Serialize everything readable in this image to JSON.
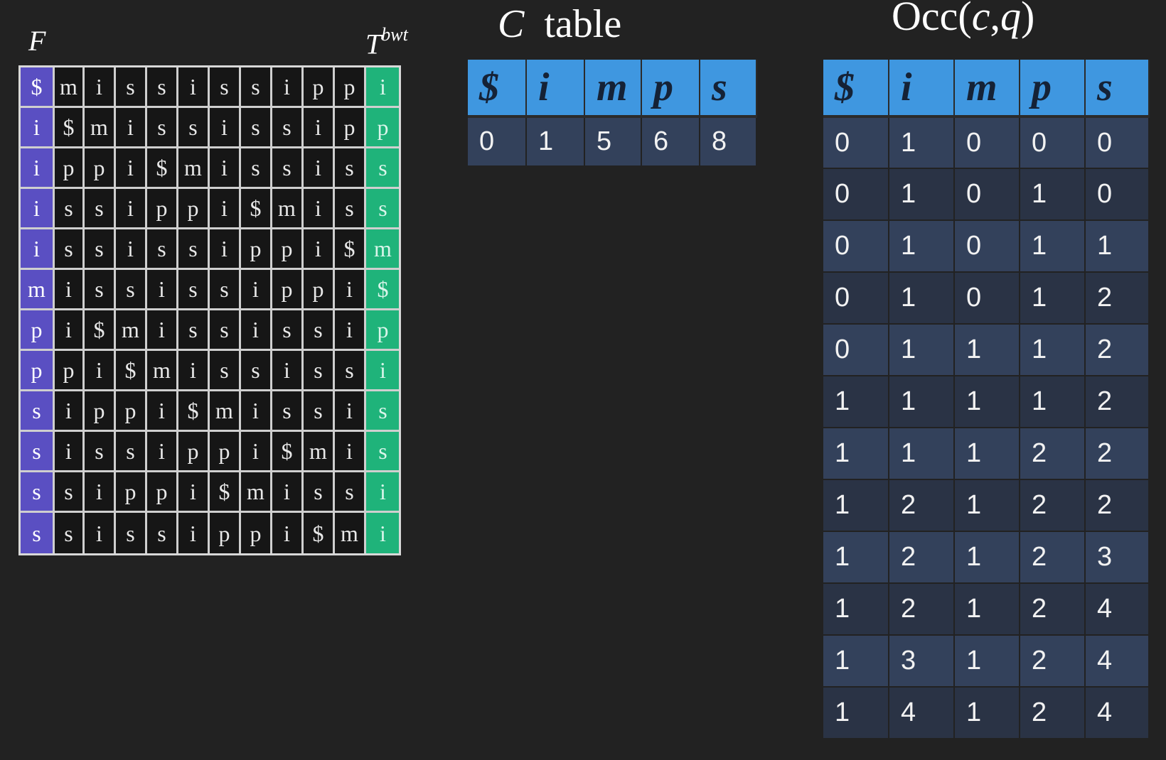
{
  "matrix": {
    "f_label": "F",
    "t_label_base": "T",
    "t_label_sup": "bwt",
    "rows": [
      [
        "$",
        "m",
        "i",
        "s",
        "s",
        "i",
        "s",
        "s",
        "i",
        "p",
        "p",
        "i"
      ],
      [
        "i",
        "$",
        "m",
        "i",
        "s",
        "s",
        "i",
        "s",
        "s",
        "i",
        "p",
        "p"
      ],
      [
        "i",
        "p",
        "p",
        "i",
        "$",
        "m",
        "i",
        "s",
        "s",
        "i",
        "s",
        "s"
      ],
      [
        "i",
        "s",
        "s",
        "i",
        "p",
        "p",
        "i",
        "$",
        "m",
        "i",
        "s",
        "s"
      ],
      [
        "i",
        "s",
        "s",
        "i",
        "s",
        "s",
        "i",
        "p",
        "p",
        "i",
        "$",
        "m"
      ],
      [
        "m",
        "i",
        "s",
        "s",
        "i",
        "s",
        "s",
        "i",
        "p",
        "p",
        "i",
        "$"
      ],
      [
        "p",
        "i",
        "$",
        "m",
        "i",
        "s",
        "s",
        "i",
        "s",
        "s",
        "i",
        "p"
      ],
      [
        "p",
        "p",
        "i",
        "$",
        "m",
        "i",
        "s",
        "s",
        "i",
        "s",
        "s",
        "i"
      ],
      [
        "s",
        "i",
        "p",
        "p",
        "i",
        "$",
        "m",
        "i",
        "s",
        "s",
        "i",
        "s"
      ],
      [
        "s",
        "i",
        "s",
        "s",
        "i",
        "p",
        "p",
        "i",
        "$",
        "m",
        "i",
        "s"
      ],
      [
        "s",
        "s",
        "i",
        "p",
        "p",
        "i",
        "$",
        "m",
        "i",
        "s",
        "s",
        "i"
      ],
      [
        "s",
        "s",
        "i",
        "s",
        "s",
        "i",
        "p",
        "p",
        "i",
        "$",
        "m",
        "i"
      ]
    ],
    "colors": {
      "f_column": "#5a4fc2",
      "t_column": "#1fb37a"
    }
  },
  "c_table": {
    "title_symbol": "C",
    "title_word": "table",
    "headers": [
      "$",
      "i",
      "m",
      "p",
      "s"
    ],
    "values": [
      "0",
      "1",
      "5",
      "6",
      "8"
    ]
  },
  "occ_table": {
    "title_prefix": "Occ(",
    "title_c": "c",
    "title_comma": ",",
    "title_q": "q",
    "title_suffix": ")",
    "headers": [
      "$",
      "i",
      "m",
      "p",
      "s"
    ],
    "rows": [
      [
        "0",
        "1",
        "0",
        "0",
        "0"
      ],
      [
        "0",
        "1",
        "0",
        "1",
        "0"
      ],
      [
        "0",
        "1",
        "0",
        "1",
        "1"
      ],
      [
        "0",
        "1",
        "0",
        "1",
        "2"
      ],
      [
        "0",
        "1",
        "1",
        "1",
        "2"
      ],
      [
        "1",
        "1",
        "1",
        "1",
        "2"
      ],
      [
        "1",
        "1",
        "1",
        "2",
        "2"
      ],
      [
        "1",
        "2",
        "1",
        "2",
        "2"
      ],
      [
        "1",
        "2",
        "1",
        "2",
        "3"
      ],
      [
        "1",
        "2",
        "1",
        "2",
        "4"
      ],
      [
        "1",
        "3",
        "1",
        "2",
        "4"
      ],
      [
        "1",
        "4",
        "1",
        "2",
        "4"
      ]
    ]
  },
  "colors": {
    "background": "#222222",
    "header_blue": "#3f97e0",
    "cell_dark_a": "#33415b",
    "cell_dark_b": "#2a3345"
  }
}
